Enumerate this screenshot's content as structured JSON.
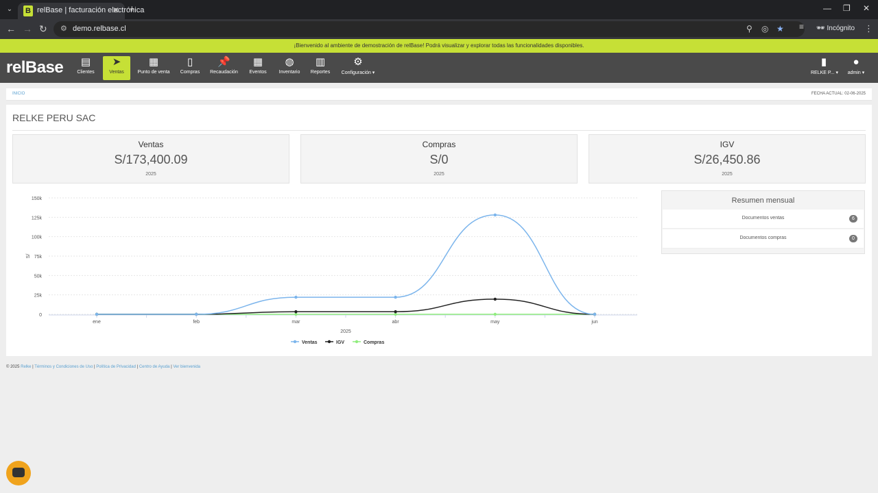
{
  "browser": {
    "tab_title": "relBase | facturación electrónica",
    "tab_favicon": "B",
    "url": "demo.relbase.cl",
    "incognito_label": "Incógnito"
  },
  "banner": "¡Bienvenido al ambiente de demostración de relBase! Podrá visualizar y explorar todas las funcionalidades disponibles.",
  "app": {
    "logo": "relBase",
    "nav": [
      {
        "label": "Clientes",
        "icon": "address-card-icon"
      },
      {
        "label": "Ventas",
        "icon": "paper-plane-icon"
      },
      {
        "label": "Punto de venta",
        "icon": "calculator-icon"
      },
      {
        "label": "Compras",
        "icon": "document-icon"
      },
      {
        "label": "Recaudación",
        "icon": "pin-icon"
      },
      {
        "label": "Eventos",
        "icon": "calendar-icon"
      },
      {
        "label": "Inventario",
        "icon": "boxes-icon"
      },
      {
        "label": "Reportes",
        "icon": "bar-chart-icon"
      },
      {
        "label": "Configuración ▾",
        "icon": "gears-icon"
      }
    ],
    "company_menu": "RELKE P... ▾",
    "user_menu": "admin ▾",
    "active_color": "#c6e036"
  },
  "breadcrumb": "INICIO",
  "fecha": "FECHA ACTUAL: 02-06-2025",
  "company_name": "RELKE PERU SAC",
  "kpis": [
    {
      "label": "Ventas",
      "value": "S/173,400.09",
      "year": "2025"
    },
    {
      "label": "Compras",
      "value": "S/0",
      "year": "2025"
    },
    {
      "label": "IGV",
      "value": "S/26,450.86",
      "year": "2025"
    }
  ],
  "resumen": {
    "title": "Resumen mensual",
    "rows": [
      {
        "label": "Documentos ventas",
        "count": "6"
      },
      {
        "label": "Documentos compras",
        "count": "0"
      }
    ]
  },
  "chart_data": {
    "type": "line",
    "categories": [
      "ene",
      "feb",
      "mar",
      "abr",
      "may",
      "jun"
    ],
    "xlabel": "2025",
    "ylabel": "S/",
    "yticks": [
      "0",
      "25k",
      "50k",
      "75k",
      "100k",
      "125k",
      "150k"
    ],
    "ylim": [
      0,
      150000
    ],
    "grid": true,
    "legend": "bottom",
    "series": [
      {
        "name": "Ventas",
        "color": "#7cb5ec",
        "values": [
          0,
          0,
          22000,
          22000,
          128000,
          0
        ]
      },
      {
        "name": "IGV",
        "color": "#222222",
        "values": [
          0,
          0,
          3300,
          3300,
          19500,
          0
        ]
      },
      {
        "name": "Compras",
        "color": "#90ed7d",
        "values": [
          0,
          0,
          0,
          0,
          0,
          0
        ]
      }
    ]
  },
  "footer": {
    "copyright": "© 2025",
    "brand": "Relke",
    "links": [
      "Términos y Condiciones de Uso",
      "Política de Privacidad",
      "Centro de Ayuda",
      "Ver bienvenida"
    ]
  }
}
